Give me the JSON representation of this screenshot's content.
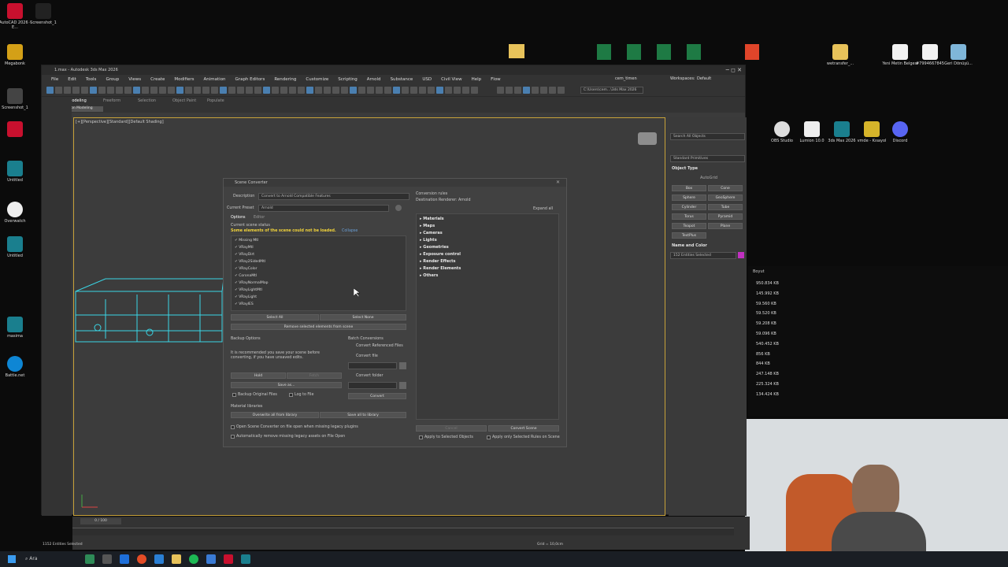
{
  "desktop_left": [
    "AutoCAD 2026 - E...",
    "Screenshot_1",
    "Megabonk",
    "",
    "Screenshot_1",
    "",
    "Overwatch",
    "Untitled",
    "Untitled",
    "",
    "Battle.net",
    "masima"
  ],
  "desktop_right": [
    "Yeni Metin Belgesi",
    "#7994667845",
    "Geri Dönüşü...",
    "wetransfer_...",
    "OBS Studio",
    "Lumion 10.0",
    "3ds Max 2026",
    "vmde - Kısayol",
    "Discord"
  ],
  "app": {
    "title": "1.max - Autodesk 3ds Max 2026",
    "menu": [
      "File",
      "Edit",
      "Tools",
      "Group",
      "Views",
      "Create",
      "Modifiers",
      "Animation",
      "Graph Editors",
      "Rendering",
      "Customize",
      "Scripting",
      "Arnold",
      "Substance",
      "USD",
      "Civil View",
      "Help",
      "Flow"
    ],
    "user": "cem_timen",
    "workspace_label": "Workspaces:",
    "workspace_value": "Default",
    "path_field": "C:\\Users\\cem...\\3ds Max 2026",
    "ribbon_tabs": [
      "Modeling",
      "Freeform",
      "Selection",
      "Object Paint",
      "Populate"
    ],
    "ribbon_sub": "Polygon Modeling",
    "viewport_label": "[+][Perspective][Standard][Default Shading]",
    "status_left": "1152 Entities Selected",
    "time_slider": "0 / 100",
    "grid": "Grid = 10,0cm"
  },
  "command_panel": {
    "search": "Search All Objects",
    "dropdown": "Standard Primitives",
    "object_type_header": "Object Type",
    "autogrid": "AutoGrid",
    "buttons": [
      "Box",
      "Cone",
      "Sphere",
      "GeoSphere",
      "Cylinder",
      "Tube",
      "Torus",
      "Pyramid",
      "Teapot",
      "Plane",
      "TextPlus"
    ],
    "name_color_header": "Name and Color",
    "name_field": "152 Entities Selected"
  },
  "dialog": {
    "title": "Scene Converter",
    "description_label": "Description",
    "description_value": "Convert to Arnold Compatible Features",
    "preset_label": "Current Preset",
    "preset_value": "Arnold",
    "tabs": [
      "Options",
      "Editor"
    ],
    "status_header": "Current scene status",
    "warning": "Some elements of the scene could not be loaded.",
    "collapse": "Collapse",
    "list": [
      "Missing Mtl",
      "VRayMtl",
      "VRayDirt",
      "VRay2SidedMtl",
      "VRayColor",
      "CoronaMtl",
      "VRayNormalMap",
      "VRayLightMtl",
      "VRayLight",
      "VRayIES"
    ],
    "select_all": "Select All",
    "select_none": "Select None",
    "remove": "Remove selected elements from scene",
    "backup_header": "Backup Options",
    "backup_text": "It is recommended you save your scene before converting, if you have unsaved edits.",
    "hold": "Hold",
    "fetch": "Fetch",
    "save_as": "Save as...",
    "backup_original": "Backup Original Files",
    "log_to_file": "Log to File",
    "batch_header": "Batch Conversions",
    "convert_ref": "Convert Referenced Files",
    "convert_file": "Convert file",
    "convert_folder": "Convert folder",
    "convert_btn": "Convert",
    "material_libs": "Material libraries",
    "overwrite_all": "Overwrite all from library",
    "save_all": "Save all to library",
    "open_on_missing": "Open Scene Converter on file open when missing legacy plugins",
    "auto_remove": "Automatically remove missing legacy assets on File Open",
    "rules_header": "Conversion rules",
    "destination": "Destination Renderer: Arnold",
    "expand_all": "Expand all",
    "rules": [
      "Materials",
      "Maps",
      "Cameras",
      "Lights",
      "Geometries",
      "Exposure control",
      "Render Effects",
      "Render Elements",
      "Others"
    ],
    "cancel": "Cancel",
    "convert_scene": "Convert Scene",
    "apply_selected": "Apply to Selected Objects",
    "apply_only": "Apply only Selected Rules on Scene"
  },
  "file_panel": {
    "header": "Boyut",
    "sizes": [
      "950.834 KB",
      "145.992 KB",
      "59.560 KB",
      "59.520 KB",
      "59.208 KB",
      "59.096 KB",
      "540.452 KB",
      "856 KB",
      "844 KB",
      "247.148 KB",
      "225.324 KB",
      "134.424 KB"
    ]
  },
  "taskbar": {
    "search": "Ara"
  },
  "colors": {
    "accent": "#c8a23a",
    "warning": "#f0d23a",
    "selection": "#3ad6e6"
  }
}
